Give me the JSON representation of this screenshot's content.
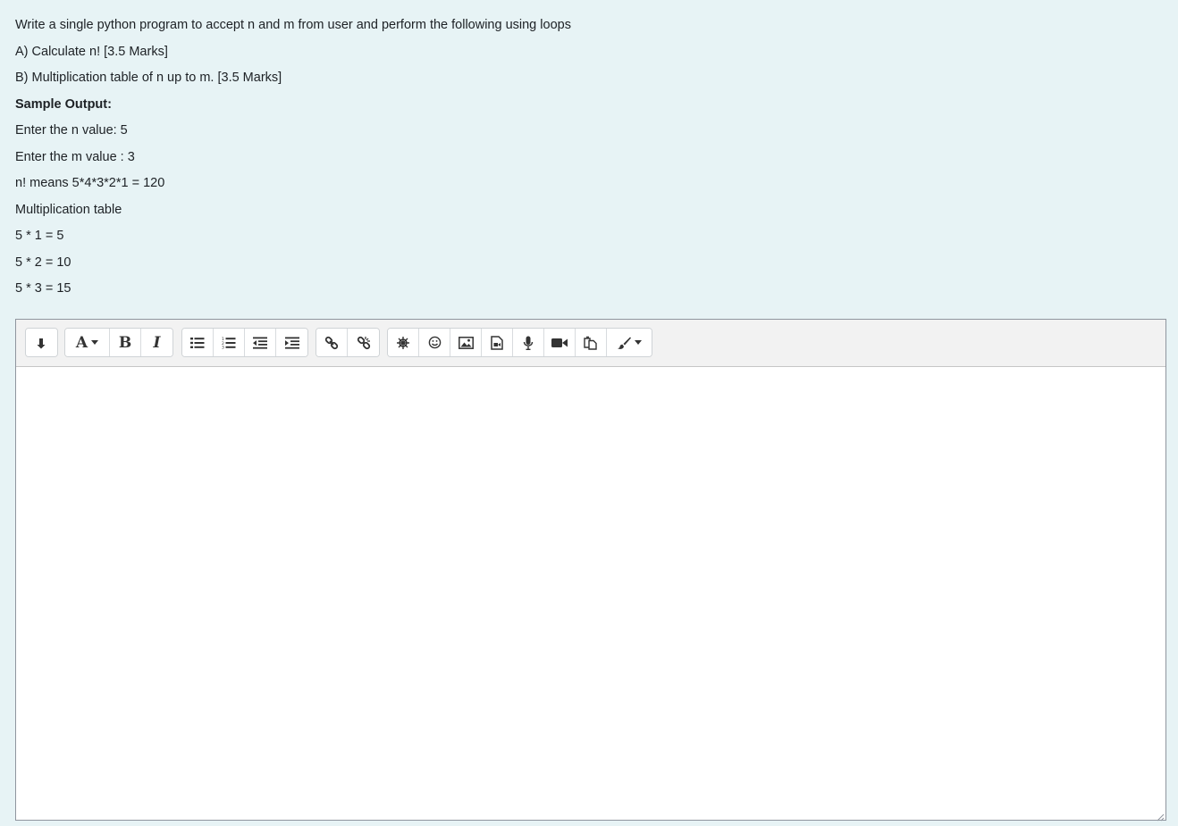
{
  "question": {
    "lines": [
      "Write a single python program to accept n and m from user and perform the following using loops",
      "A) Calculate n!  [3.5 Marks]",
      "B) Multiplication table of n up to m. [3.5 Marks]",
      "Sample Output:",
      "Enter the n value: 5",
      "Enter the m value : 3",
      "n! means 5*4*3*2*1 = 120",
      "Multiplication table",
      "5 * 1 = 5",
      "5 * 2 = 10",
      "5 * 3 = 15"
    ]
  },
  "toolbar": {
    "buttons": [
      {
        "icon": "collapse-toolbar-icon"
      },
      {
        "icon": "font-style-dropdown-icon",
        "label": "A"
      },
      {
        "icon": "bold-icon",
        "label": "B"
      },
      {
        "icon": "italic-icon",
        "label": "I"
      },
      {
        "icon": "unordered-list-icon"
      },
      {
        "icon": "ordered-list-icon"
      },
      {
        "icon": "outdent-icon"
      },
      {
        "icon": "indent-icon"
      },
      {
        "icon": "link-icon"
      },
      {
        "icon": "unlink-icon"
      },
      {
        "icon": "special-character-icon"
      },
      {
        "icon": "emoticon-icon"
      },
      {
        "icon": "insert-image-icon"
      },
      {
        "icon": "insert-media-icon"
      },
      {
        "icon": "record-audio-icon"
      },
      {
        "icon": "record-video-icon"
      },
      {
        "icon": "manage-files-icon"
      },
      {
        "icon": "font-color-dropdown-icon"
      }
    ]
  },
  "editor": {
    "content": ""
  },
  "colors": {
    "page_bg": "#e7f3f5",
    "toolbar_bg": "#f2f2f2",
    "icon": "#333333"
  }
}
